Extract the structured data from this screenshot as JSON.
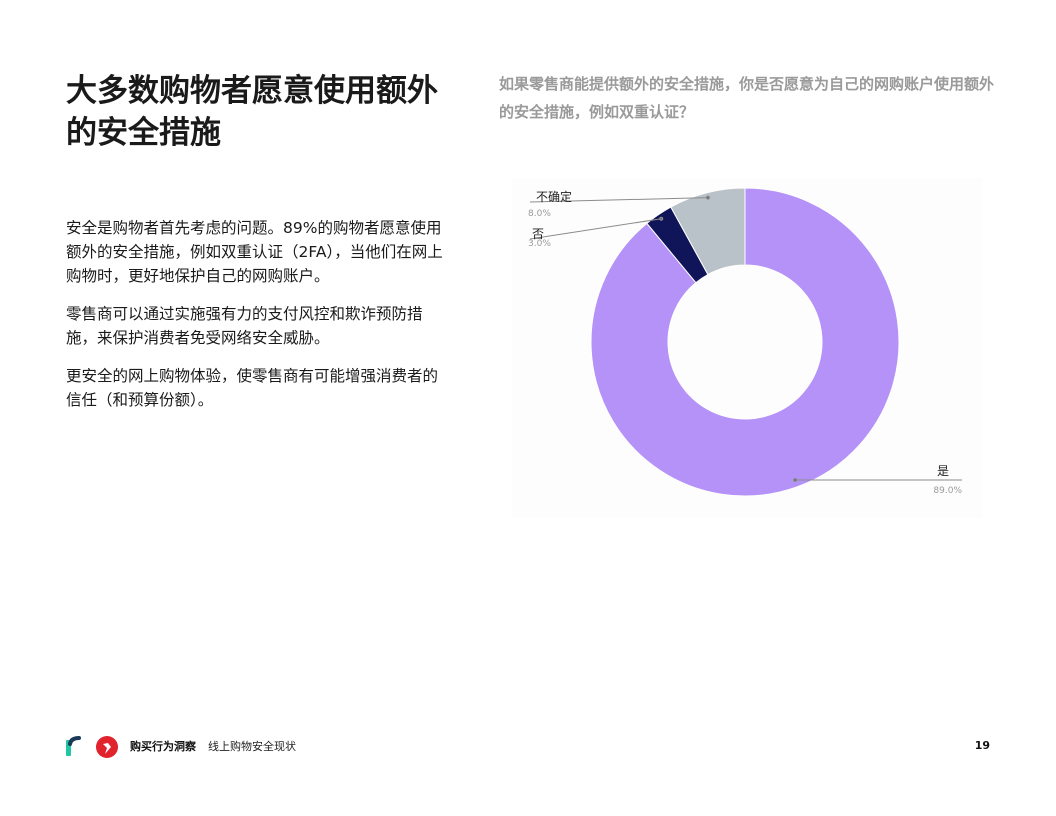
{
  "page": {
    "title": "大多数购物者愿意使用额外的安全措施",
    "paragraphs": [
      "安全是购物者首先考虑的问题。89%的购物者愿意使用额外的安全措施，例如双重认证（2FA），当他们在网上购物时，更好地保护自己的网购账户。",
      "零售商可以通过实施强有力的支付风控和欺诈预防措施，来保护消费者免受网络安全威胁。",
      "更安全的网上购物体验，使零售商有可能增强消费者的信任（和预算份额）。"
    ],
    "question": "如果零售商能提供额外的安全措施，你是否愿意为自己的网购账户使用额外的安全措施，例如双重认证？"
  },
  "chart_data": {
    "type": "pie",
    "donut": true,
    "categories": [
      "是",
      "否",
      "不确定"
    ],
    "values": [
      89.0,
      3.0,
      8.0
    ],
    "value_labels": [
      "89.0%",
      "3.0%",
      "8.0%"
    ],
    "colors": [
      "#b592f8",
      "#0f1558",
      "#b9c1c9"
    ],
    "start": "top",
    "direction": "clockwise"
  },
  "footer": {
    "brand": "购买行为洞察",
    "subtitle": "线上购物安全现状",
    "page_number": "19",
    "logo_colors": [
      "#1fc8a0",
      "#e0232c",
      "#1b3a57"
    ]
  }
}
